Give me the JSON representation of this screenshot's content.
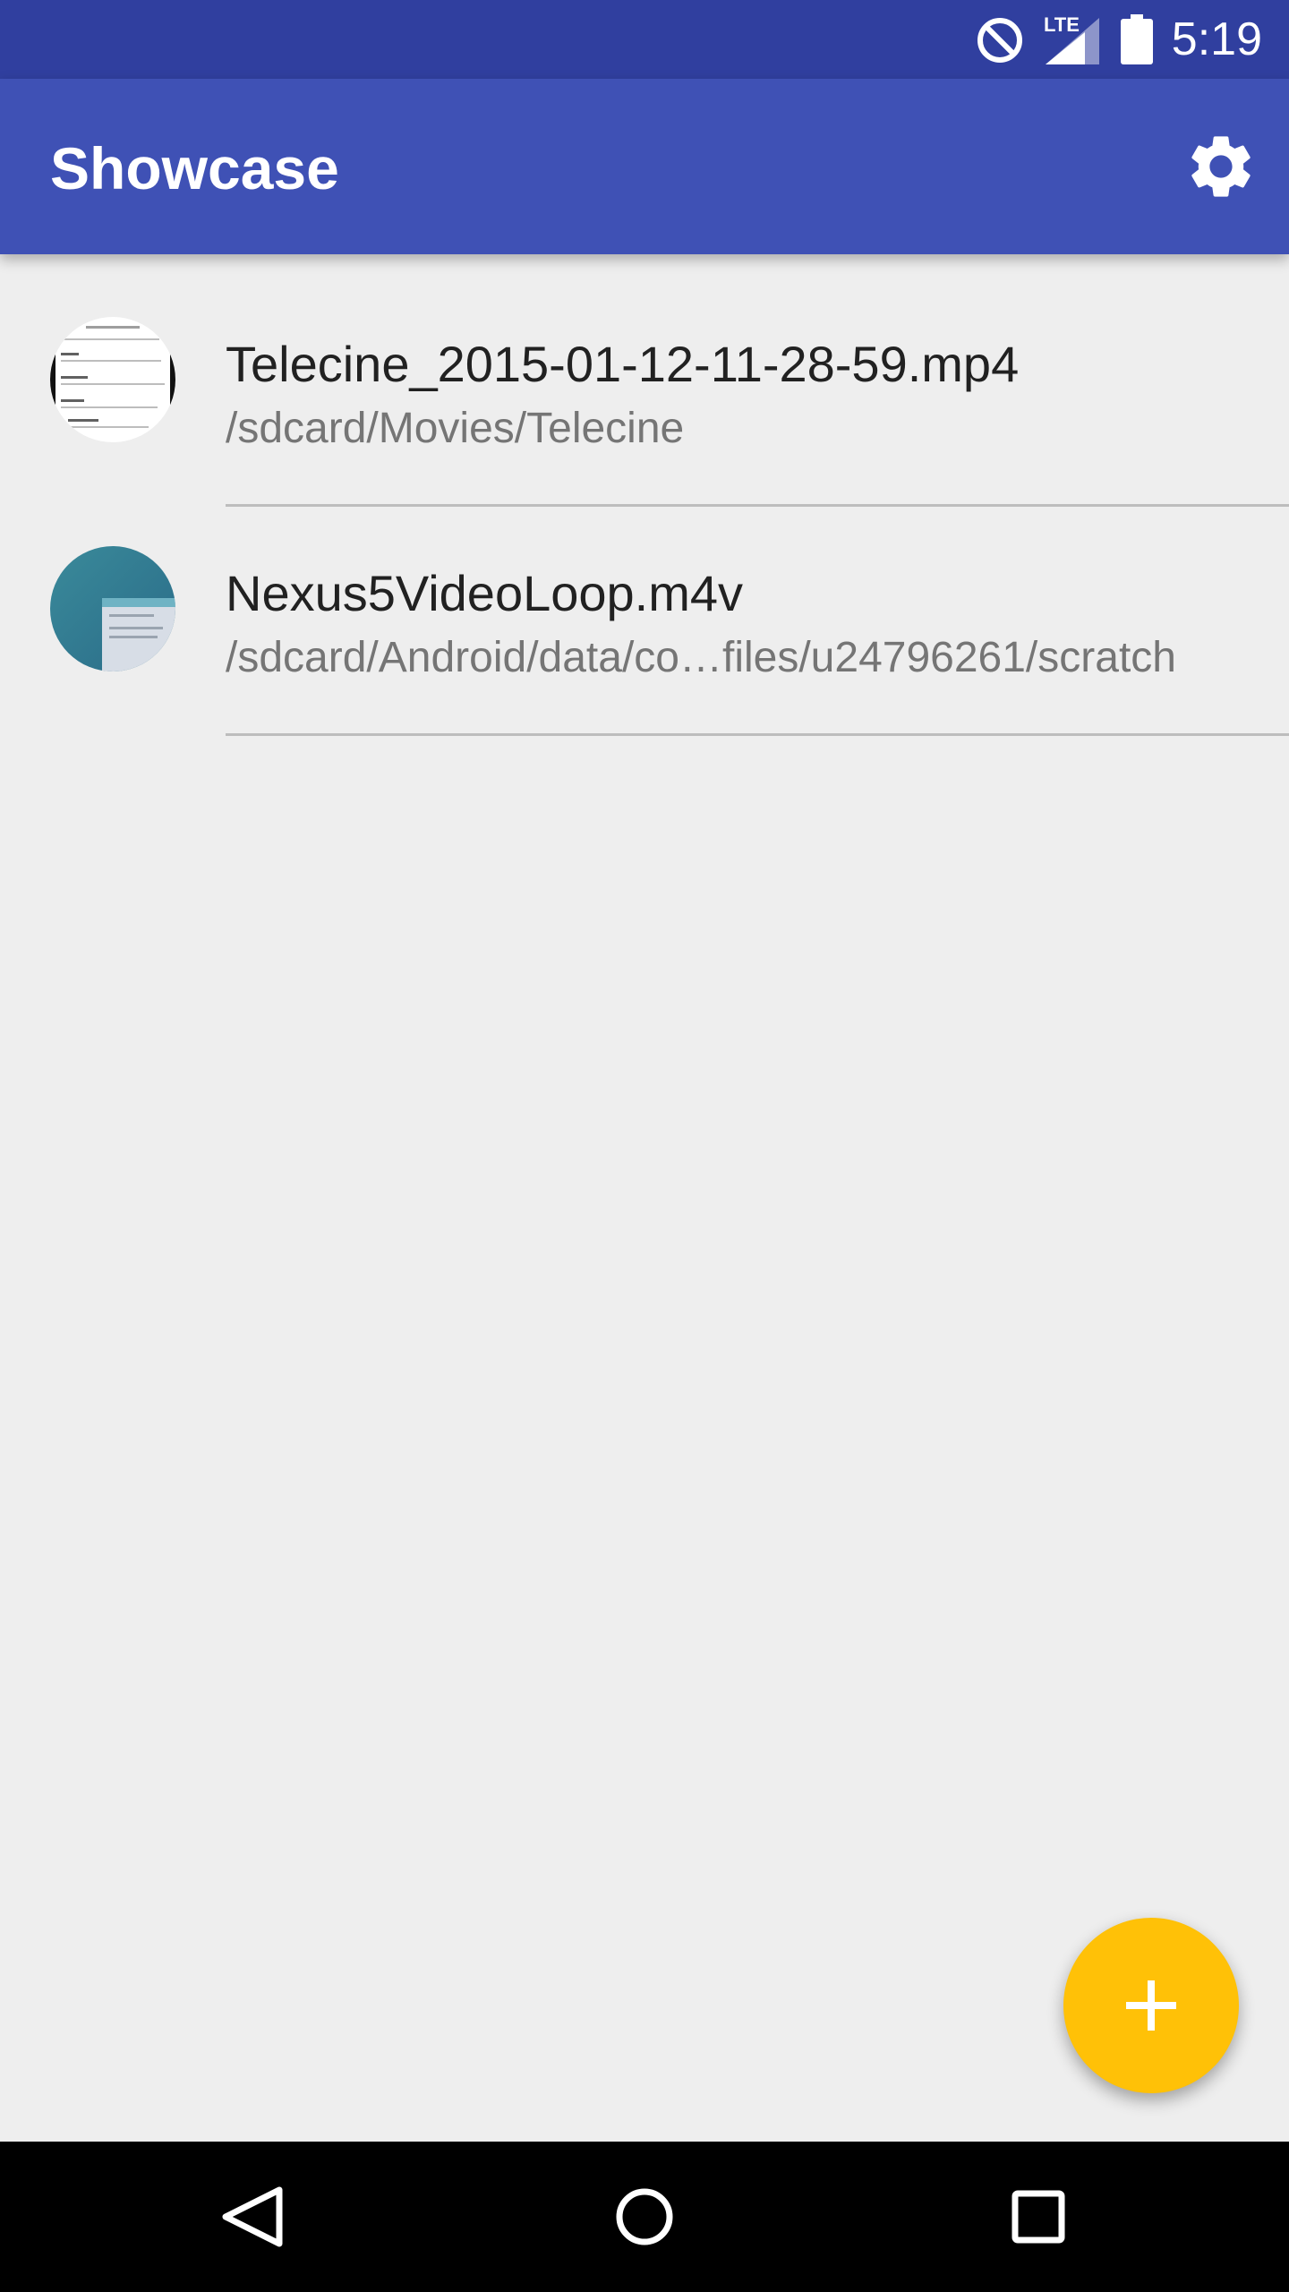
{
  "status_bar": {
    "time": "5:19",
    "network_label": "LTE",
    "icons": [
      "do-not-disturb-icon",
      "signal-icon",
      "battery-icon"
    ]
  },
  "app_bar": {
    "title": "Showcase",
    "settings_icon": "gear-icon"
  },
  "list": {
    "items": [
      {
        "title": "Telecine_2015-01-12-11-28-59.mp4",
        "subtitle": "/sdcard/Movies/Telecine",
        "thumbnail": "document-thumbnail"
      },
      {
        "title": "Nexus5VideoLoop.m4v",
        "subtitle": "/sdcard/Android/data/co…files/u24796261/scratch",
        "thumbnail": "teal-screen-thumbnail"
      }
    ]
  },
  "fab": {
    "icon": "plus-icon"
  },
  "nav_bar": {
    "icons": [
      "back-icon",
      "home-icon",
      "recents-icon"
    ]
  },
  "colors": {
    "status_bar": "#303f9f",
    "primary": "#3f51b5",
    "accent": "#ffc107",
    "background": "#eeeeee"
  }
}
